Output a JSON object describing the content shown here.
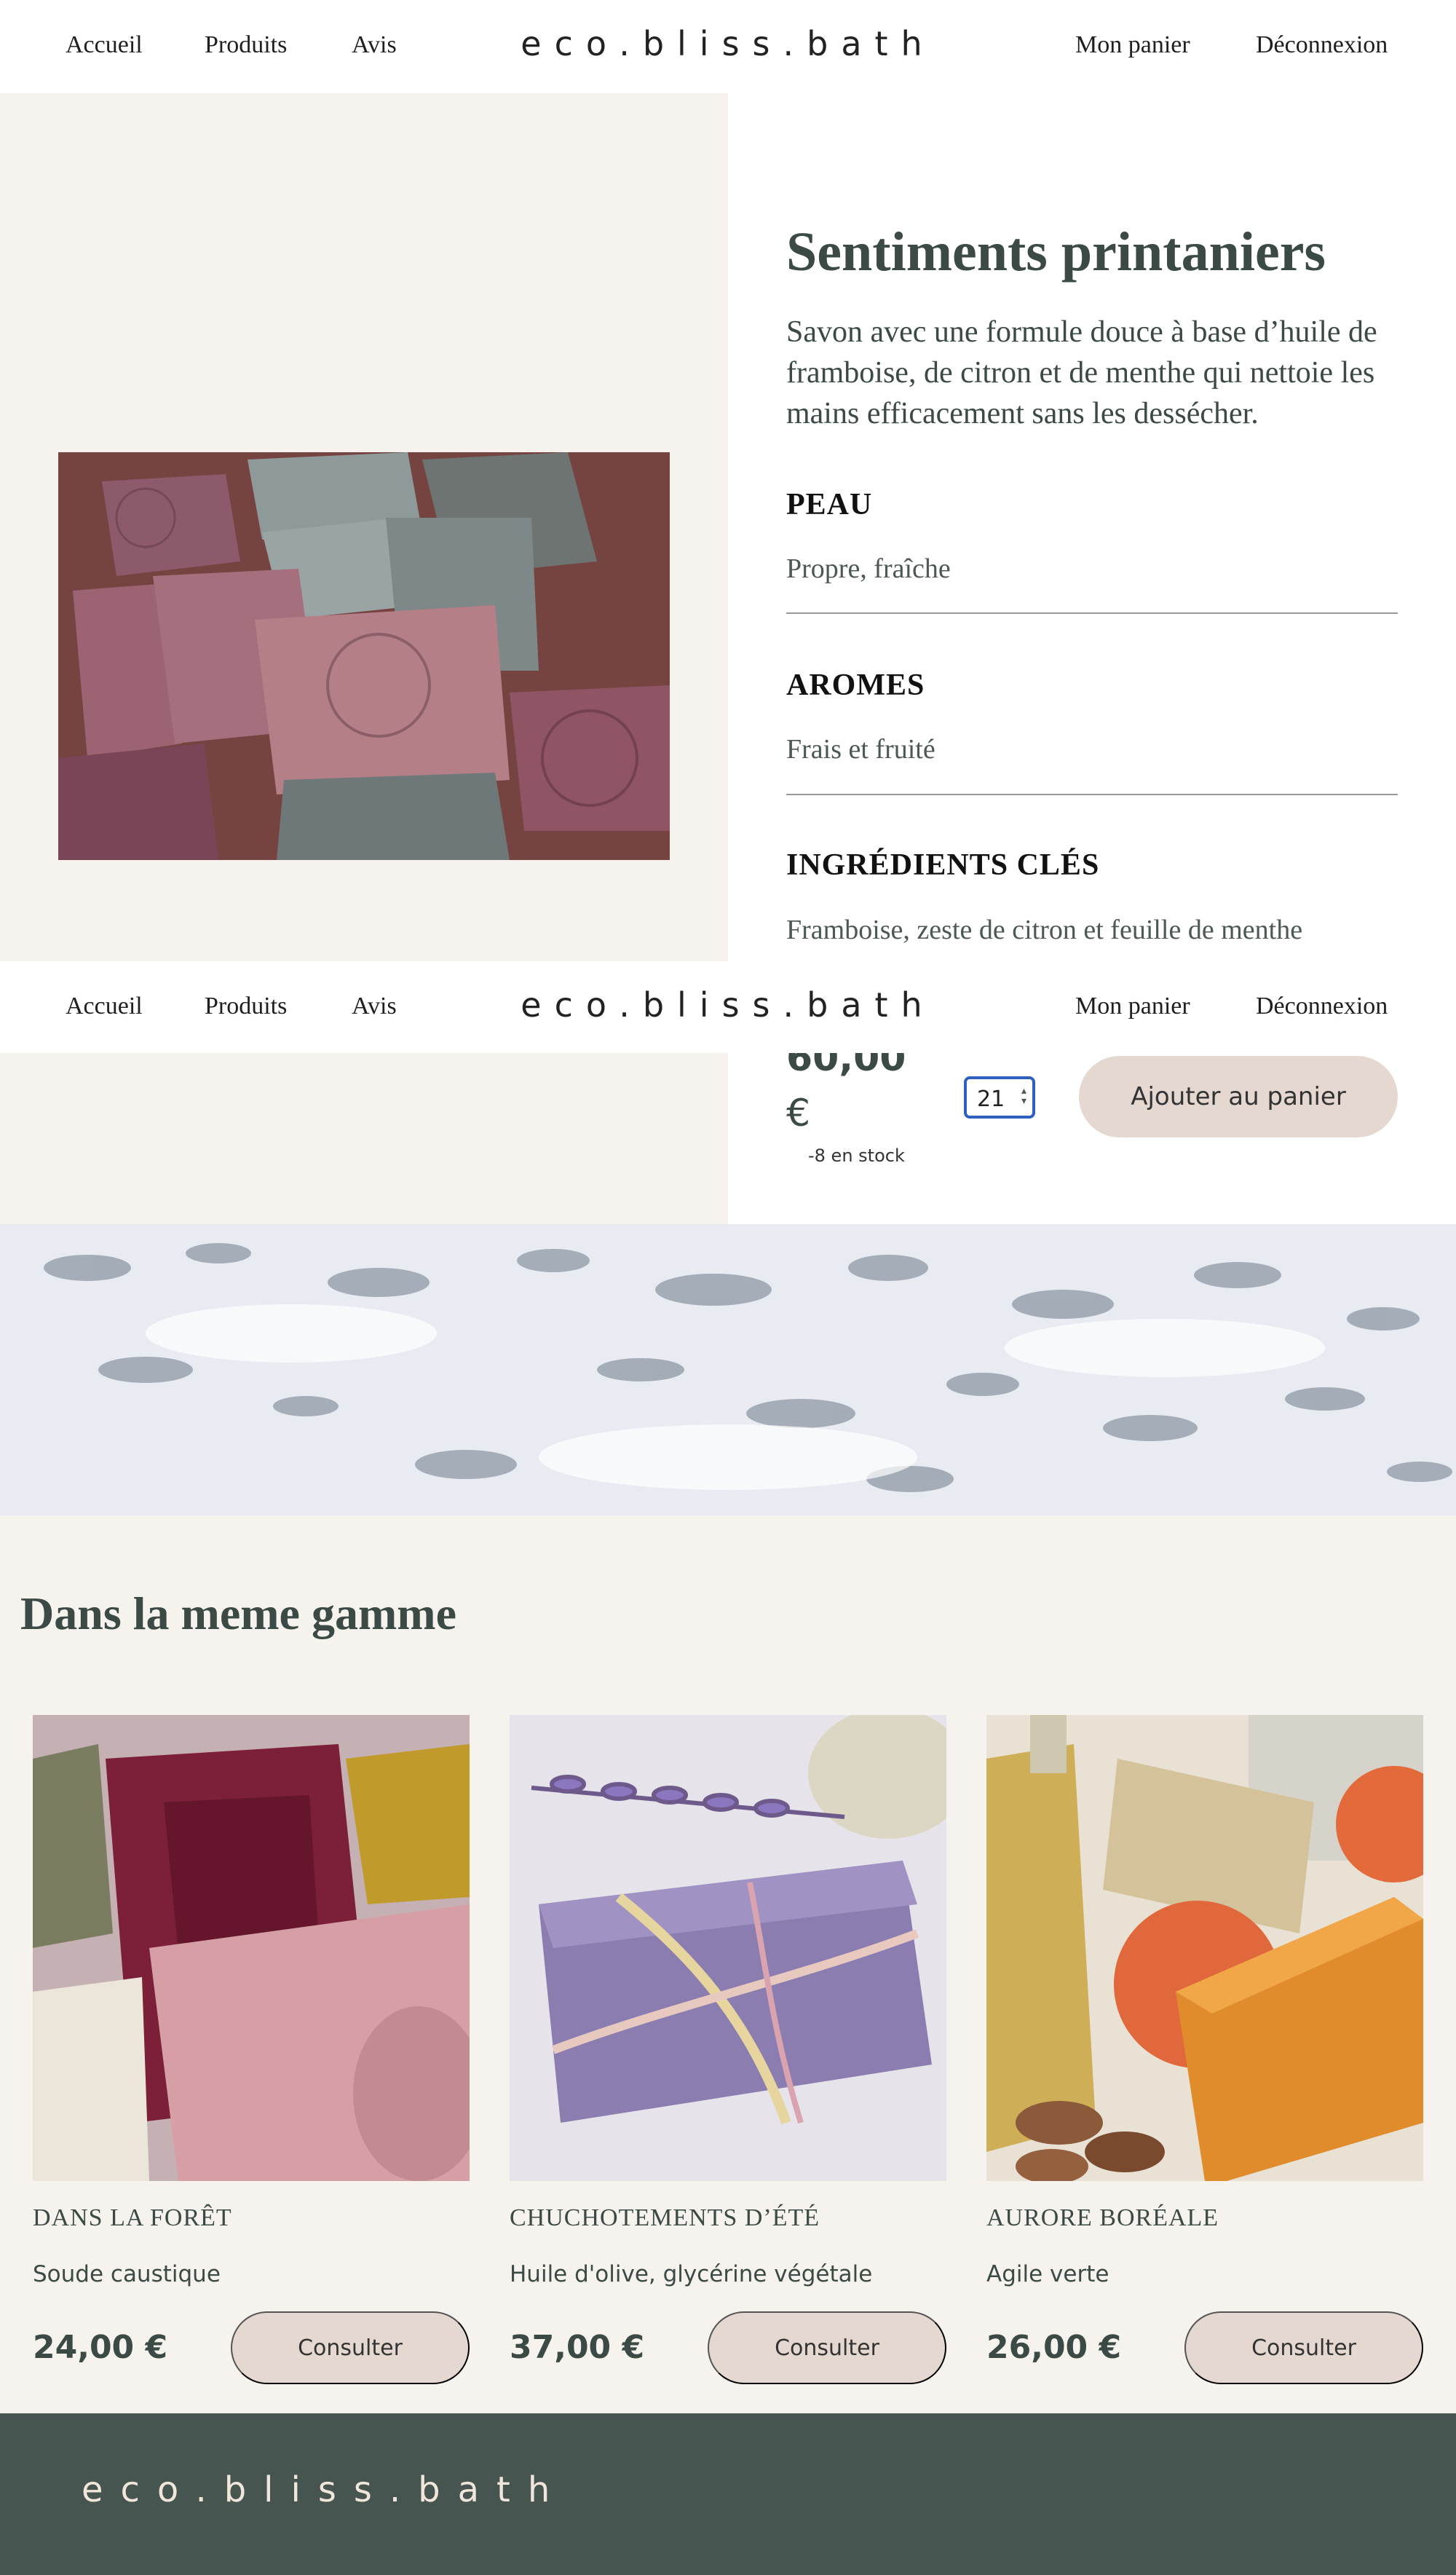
{
  "nav": {
    "home": "Accueil",
    "products": "Produits",
    "reviews": "Avis",
    "logo": "eco.bliss.bath",
    "cart": "Mon panier",
    "logout": "Déconnexion"
  },
  "product": {
    "title": "Sentiments printaniers",
    "description": "Savon avec une formule douce à base d’huile de framboise, de citron et de menthe qui nettoie les mains efficacement sans les dessécher.",
    "attributes": [
      {
        "heading": "PEAU",
        "value": "Propre, fraîche"
      },
      {
        "heading": "AROMES",
        "value": "Frais et fruité"
      },
      {
        "heading": "INGRÉDIENTS CLÉS",
        "value": "Framboise, zeste de citron et feuille de menthe"
      }
    ],
    "price_amount": "60,00",
    "price_currency": "€",
    "stock": "-8 en stock",
    "quantity": "21",
    "add_to_cart": "Ajouter au panier"
  },
  "range": {
    "title": "Dans la meme gamme",
    "cards": [
      {
        "name": "DANS LA FORÊT",
        "ingredients": "Soude caustique",
        "price": "24,00 €",
        "button": "Consulter"
      },
      {
        "name": "CHUCHOTEMENTS D’ÉTÉ",
        "ingredients": "Huile d'olive, glycérine végétale",
        "price": "37,00 €",
        "button": "Consulter"
      },
      {
        "name": "AURORE BORÉALE",
        "ingredients": "Agile verte",
        "price": "26,00 €",
        "button": "Consulter"
      }
    ]
  },
  "footer": {
    "logo": "eco.bliss.bath"
  },
  "colors": {
    "accent_text": "#3b4a44",
    "button_bg": "#e4d8d0",
    "section_bg": "#f6f2ee",
    "footer_bg": "#465550",
    "input_focus": "#2f5fbf"
  }
}
